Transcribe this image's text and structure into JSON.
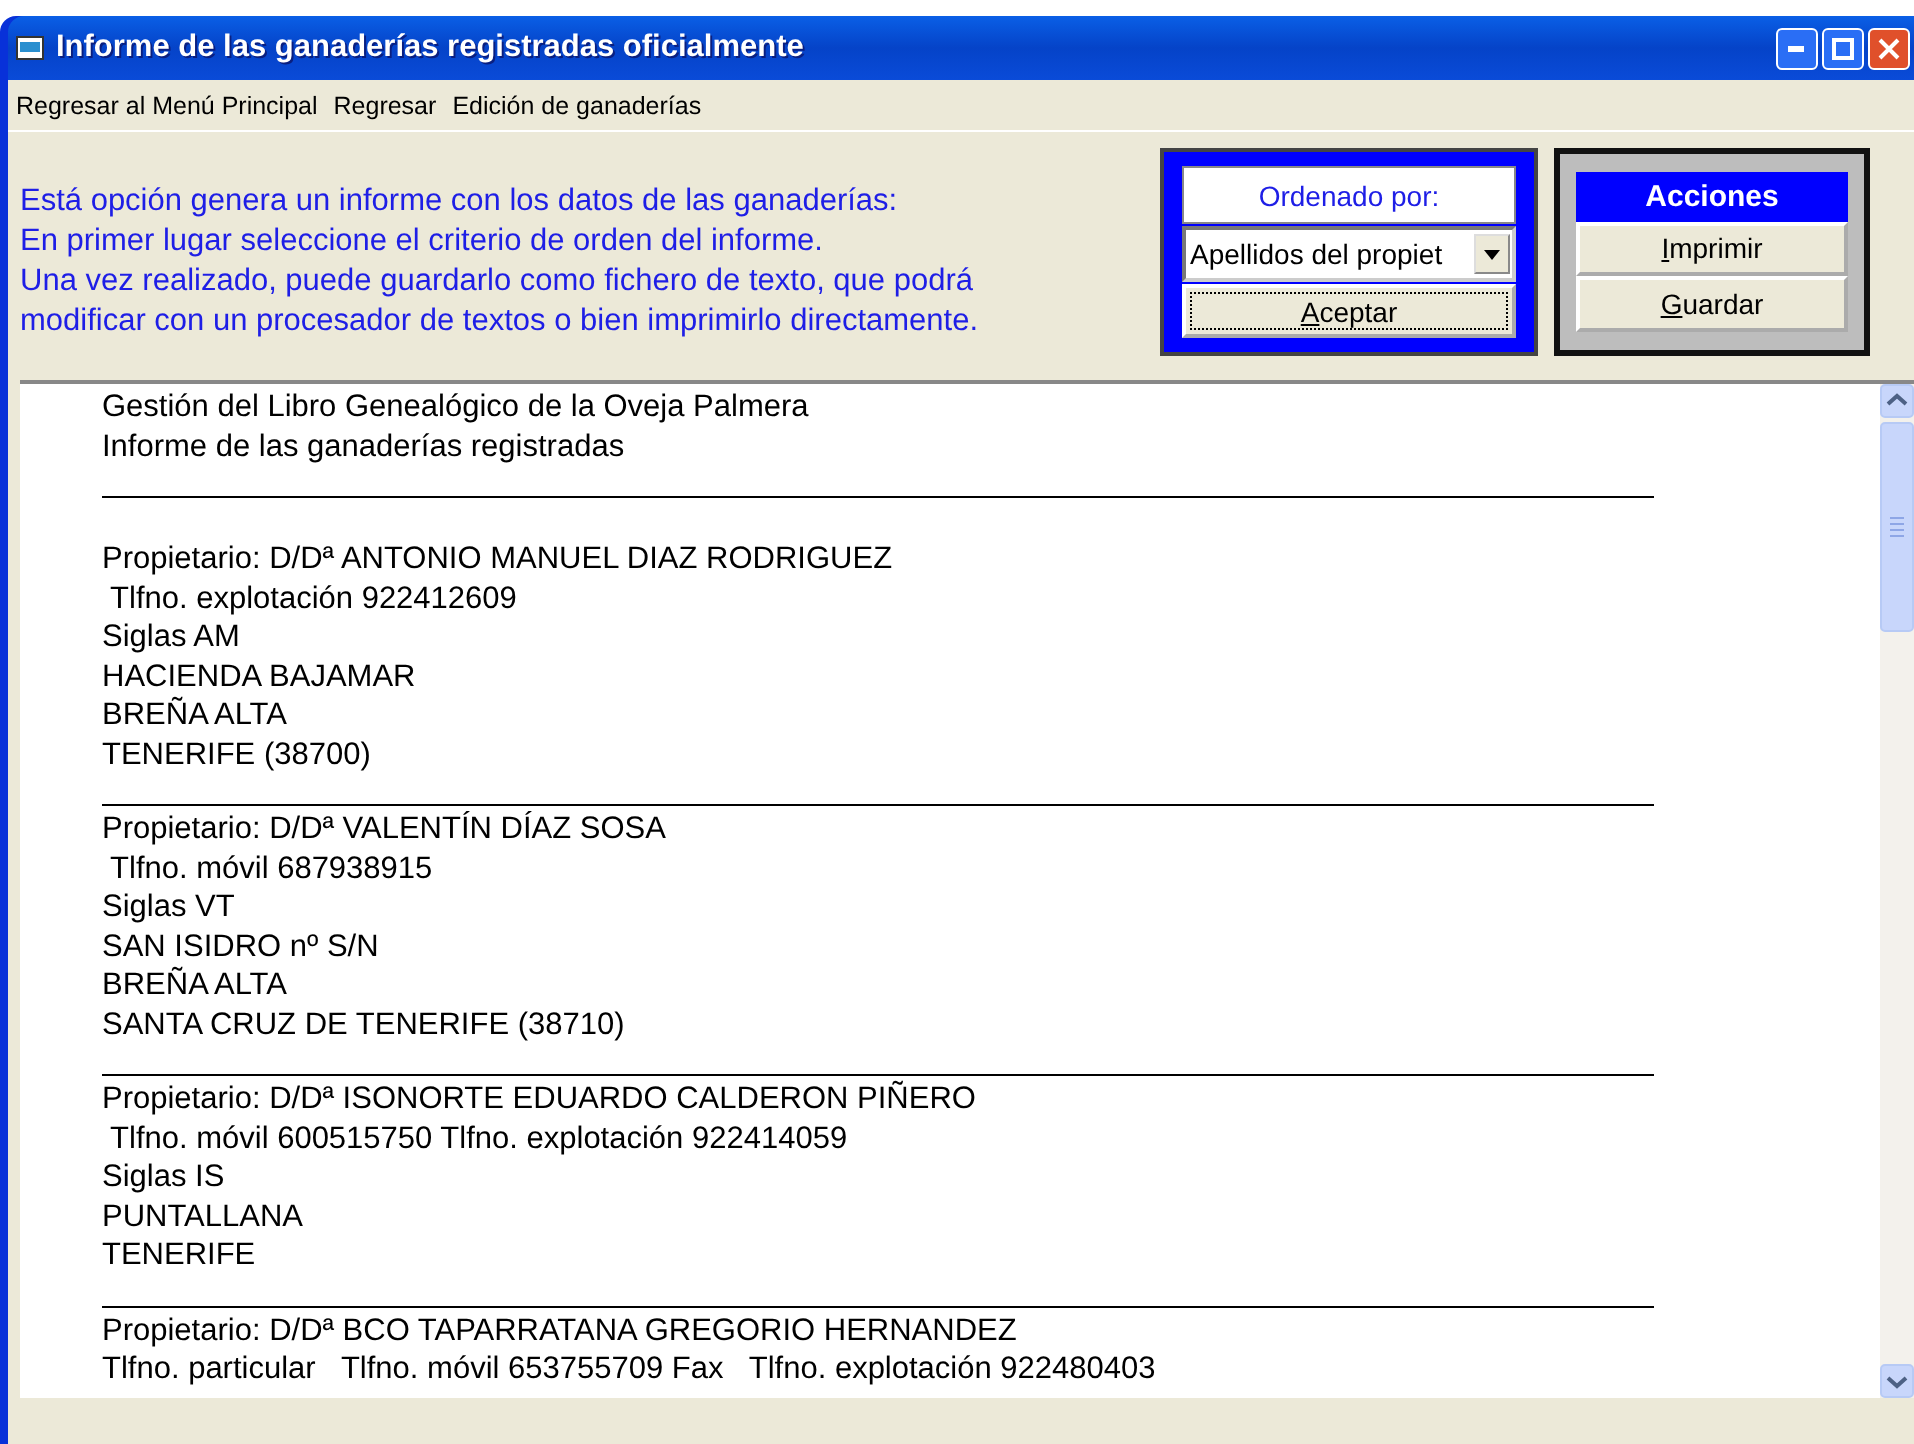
{
  "window": {
    "title": "Informe de las ganaderías registradas oficialmente"
  },
  "menu": [
    "Regresar al Menú Principal",
    "Regresar",
    "Edición de ganaderías"
  ],
  "info": [
    "Está opción genera un informe con los datos de las ganaderías:",
    "En primer  lugar seleccione el criterio de orden del informe.",
    "Una vez realizado, puede guardarlo como fichero de texto, que podrá",
    "modificar con un procesador de textos  o bien imprimirlo directamente."
  ],
  "order_panel": {
    "label": "Ordenado por:",
    "value": "Apellidos del propiet",
    "button": {
      "mnemonic": "A",
      "rest": "ceptar"
    }
  },
  "actions_panel": {
    "title": "Acciones",
    "buttons": [
      {
        "mnemonic": "I",
        "rest": "mprimir"
      },
      {
        "mnemonic": "G",
        "rest": "uardar"
      }
    ]
  },
  "report": {
    "header": [
      "Gestión del Libro Genealógico de la Oveja Palmera",
      "Informe de las ganaderías registradas"
    ],
    "entries": [
      {
        "lines": [
          "Propietario: D/Dª ANTONIO MANUEL DIAZ RODRIGUEZ",
          " Tlfno. explotación 922412609",
          "Siglas AM",
          "HACIENDA BAJAMAR",
          "BREÑA ALTA",
          "TENERIFE (38700)"
        ]
      },
      {
        "lines": [
          "Propietario: D/Dª VALENTÍN DÍAZ SOSA",
          " Tlfno. móvil 687938915",
          "Siglas VT",
          "SAN ISIDRO nº S/N",
          "BREÑA ALTA",
          "SANTA CRUZ DE TENERIFE (38710)"
        ]
      },
      {
        "lines": [
          "Propietario: D/Dª ISONORTE EDUARDO CALDERON PIÑERO",
          " Tlfno. móvil 600515750 Tlfno. explotación 922414059",
          "Siglas IS",
          "PUNTALLANA",
          "TENERIFE"
        ]
      },
      {
        "lines": [
          "Propietario: D/Dª BCO TAPARRATANA GREGORIO HERNANDEZ",
          "Tlfno. particular   Tlfno. móvil 653755709 Fax   Tlfno. explotación 922480403"
        ]
      }
    ]
  }
}
